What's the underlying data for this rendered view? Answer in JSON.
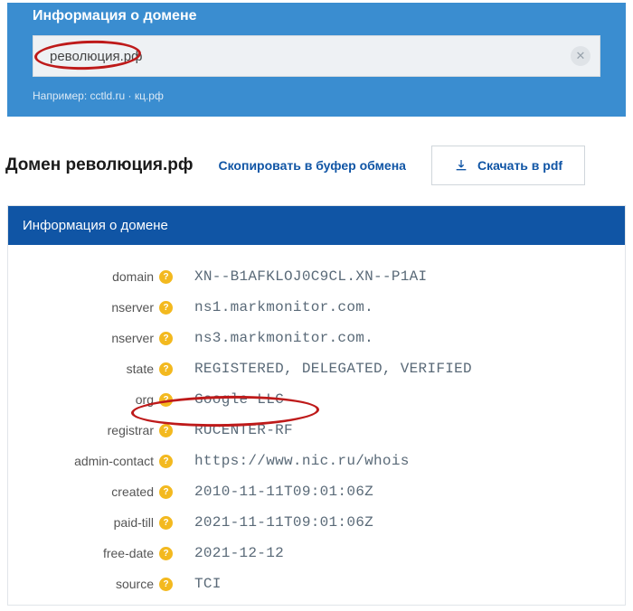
{
  "search": {
    "panel_title": "Информация о домене",
    "input_value": "революция.рф",
    "example_prefix": "Например: ",
    "example1": "cctld.ru",
    "example_sep": " · ",
    "example2": "кц.рф"
  },
  "title_row": {
    "domain_heading": "Домен революция.рф",
    "copy_label": "Скопировать в буфер обмена",
    "pdf_label": "Скачать в pdf"
  },
  "info": {
    "header": "Информация о домене",
    "rows": [
      {
        "label": "domain",
        "value": "XN--B1AFKLOJ0C9CL.XN--P1AI"
      },
      {
        "label": "nserver",
        "value": "ns1.markmonitor.com."
      },
      {
        "label": "nserver",
        "value": "ns3.markmonitor.com."
      },
      {
        "label": "state",
        "value": "REGISTERED, DELEGATED, VERIFIED"
      },
      {
        "label": "org",
        "value": "Google LLC"
      },
      {
        "label": "registrar",
        "value": "RUCENTER-RF"
      },
      {
        "label": "admin-contact",
        "value": "https://www.nic.ru/whois"
      },
      {
        "label": "created",
        "value": "2010-11-11T09:01:06Z"
      },
      {
        "label": "paid-till",
        "value": "2021-11-11T09:01:06Z"
      },
      {
        "label": "free-date",
        "value": "2021-12-12"
      },
      {
        "label": "source",
        "value": "TCI"
      }
    ]
  }
}
